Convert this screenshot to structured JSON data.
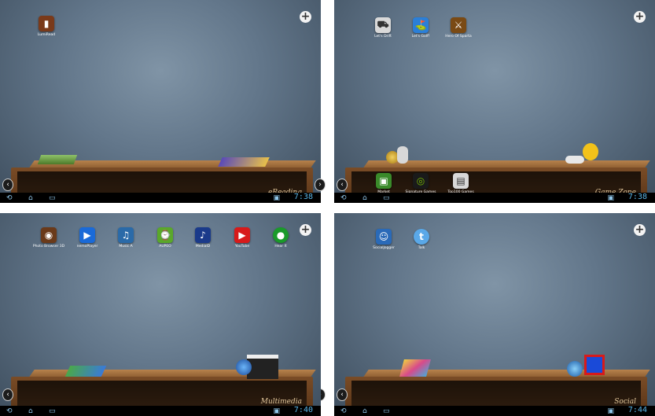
{
  "panels": [
    {
      "shelf_label": "eReading",
      "apps": [
        {
          "label": "LumiRead",
          "icon": "books-icon",
          "color": "#7a3a1a"
        }
      ],
      "shelf_apps": [],
      "clock": "7:38"
    },
    {
      "shelf_label": "Game Zone",
      "apps": [
        {
          "label": "Let's Drift",
          "icon": "car-icon",
          "color": "#d9d9d9"
        },
        {
          "label": "Let's Golf!",
          "icon": "golf-icon",
          "color": "#2b7fd8"
        },
        {
          "label": "Hero Of Sparta",
          "icon": "warrior-icon",
          "color": "#7a4a14"
        }
      ],
      "shelf_apps": [
        {
          "label": "Market",
          "icon": "market-bag-icon",
          "color": "#3a8a2a"
        },
        {
          "label": "Signature Games",
          "icon": "nvidia-eye-icon",
          "color": "#2a8a1a"
        },
        {
          "label": "Top100 Games",
          "icon": "top100-icon",
          "color": "#d8d8d8"
        }
      ],
      "clock": "7:38"
    },
    {
      "shelf_label": "Multimedia",
      "apps": [
        {
          "label": "Photo Browser 3D",
          "icon": "photo-icon",
          "color": "#6a3a1a"
        },
        {
          "label": "nemoPlayer",
          "icon": "play-icon",
          "color": "#1a6ad8"
        },
        {
          "label": "Music A",
          "icon": "music-note-icon",
          "color": "#2a6aa8"
        },
        {
          "label": "AUPEO",
          "icon": "aupeo-icon",
          "color": "#5aa82a"
        },
        {
          "label": "MediaID",
          "icon": "mediaid-icon",
          "color": "#1a3a8a"
        },
        {
          "label": "YouTube",
          "icon": "youtube-icon",
          "color": "#d81a1a"
        },
        {
          "label": "Hear It",
          "icon": "hear-it-icon",
          "color": "#1a9a2a"
        }
      ],
      "shelf_apps": [],
      "clock": "7:40"
    },
    {
      "shelf_label": "Social",
      "apps": [
        {
          "label": "SocialJogger",
          "icon": "social-jogger-icon",
          "color": "#2a6ab8"
        },
        {
          "label": "Talk",
          "icon": "talk-bubble-icon",
          "color": "#5aa8e8"
        }
      ],
      "shelf_apps": [],
      "clock": "7:44"
    }
  ],
  "icon_glyphs": {
    "books-icon": "▮",
    "car-icon": "⛟",
    "golf-icon": "⛳",
    "warrior-icon": "⚔",
    "photo-icon": "◉",
    "play-icon": "▶",
    "music-note-icon": "♫",
    "aupeo-icon": "⌚",
    "mediaid-icon": "♪",
    "youtube-icon": "▶",
    "hear-it-icon": "●",
    "social-jogger-icon": "☺",
    "talk-bubble-icon": "t",
    "market-bag-icon": "▣",
    "nvidia-eye-icon": "◎",
    "top100-icon": "▤"
  },
  "plus_glyph": "+",
  "left_arrow": "‹",
  "right_arrow": "›"
}
